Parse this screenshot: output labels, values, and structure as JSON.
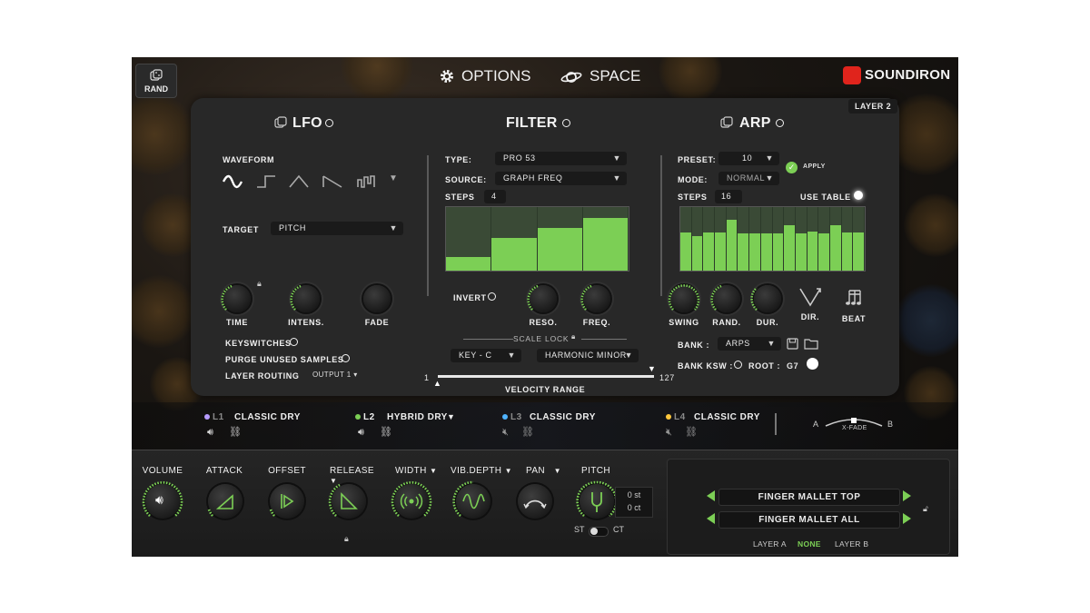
{
  "header": {
    "rand_label": "RAND",
    "options_label": "OPTIONS",
    "space_label": "SPACE",
    "brand": "SOUNDIRON",
    "layer_badge": "LAYER 2"
  },
  "lfo": {
    "title": "LFO",
    "waveform_label": "WAVEFORM",
    "target_label": "TARGET",
    "target_value": "PITCH",
    "knobs": [
      "TIME",
      "INTENS.",
      "FADE"
    ],
    "keyswitches_label": "KEYSWITCHES",
    "purge_label": "PURGE UNUSED SAMPLES",
    "routing_label": "LAYER ROUTING",
    "routing_value": "OUTPUT 1"
  },
  "filter": {
    "title": "FILTER",
    "type_label": "TYPE:",
    "type_value": "PRO 53",
    "source_label": "SOURCE:",
    "source_value": "GRAPH FREQ",
    "steps_label": "STEPS",
    "steps_value": "4",
    "step_levels": [
      0.22,
      0.52,
      0.67,
      0.83
    ],
    "invert_label": "INVERT",
    "knobs": [
      "RESO.",
      "FREQ."
    ],
    "scale_lock_label": "SCALE LOCK",
    "key_value": "KEY - C",
    "scale_value": "HARMONIC MINOR",
    "vel_min": "1",
    "vel_max": "127",
    "vel_label": "VELOCITY RANGE"
  },
  "arp": {
    "title": "ARP",
    "preset_label": "PRESET:",
    "preset_value": "10",
    "apply_label": "APPLY",
    "mode_label": "MODE:",
    "mode_value": "NORMAL",
    "steps_label": "STEPS",
    "steps_value": "16",
    "use_table_label": "USE TABLE",
    "step_levels": [
      0.6,
      0.55,
      0.6,
      0.6,
      0.8,
      0.58,
      0.58,
      0.58,
      0.58,
      0.72,
      0.58,
      0.62,
      0.58,
      0.72,
      0.6,
      0.6
    ],
    "knobs": [
      "SWING",
      "RAND.",
      "DUR."
    ],
    "dir_label": "DIR.",
    "beat_label": "BEAT",
    "bank_label": "BANK :",
    "bank_value": "ARPS",
    "bank_ksw_label": "BANK KSW :",
    "root_label": "ROOT :",
    "root_value": "G7"
  },
  "layers": [
    {
      "id": "L1",
      "name": "CLASSIC DRY",
      "color": "#b79cff",
      "active": false
    },
    {
      "id": "L2",
      "name": "HYBRID DRY",
      "color": "#7ccf55",
      "active": true
    },
    {
      "id": "L3",
      "name": "CLASSIC DRY",
      "color": "#4fb3ff",
      "active": false
    },
    {
      "id": "L4",
      "name": "CLASSIC DRY",
      "color": "#ffc83d",
      "active": false
    }
  ],
  "xfade": {
    "a": "A",
    "b": "B",
    "label": "X-FADE"
  },
  "bottom": {
    "knobs": [
      "VOLUME",
      "ATTACK",
      "OFFSET",
      "RELEASE",
      "WIDTH",
      "VIB.DEPTH",
      "PAN",
      "PITCH"
    ],
    "pitch_st": "0 st",
    "pitch_ct": "0 ct",
    "st_label": "ST",
    "ct_label": "CT"
  },
  "mallets": {
    "top": "FINGER MALLET TOP",
    "all": "FINGER MALLET ALL",
    "layer_a": "LAYER A",
    "none": "NONE",
    "layer_b": "LAYER B"
  },
  "colors": {
    "accent": "#7ccf55",
    "panel": "#282828",
    "background": "#ffffff"
  }
}
